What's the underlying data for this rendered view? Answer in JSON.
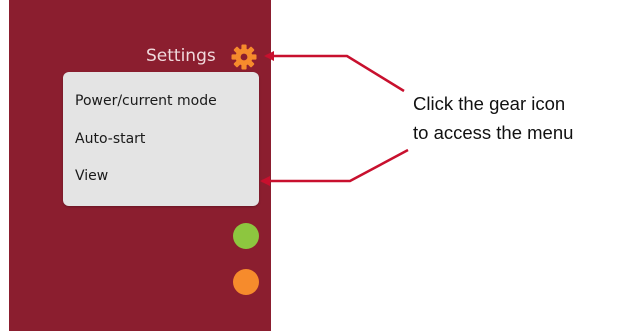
{
  "settings": {
    "label": "Settings",
    "icon": "gear-icon",
    "icon_color": "#f68b2c"
  },
  "menu": {
    "items": [
      {
        "label": "Power/current mode"
      },
      {
        "label": "Auto-start"
      },
      {
        "label": "View"
      }
    ]
  },
  "status_indicators": [
    {
      "color": "#8dc63f"
    },
    {
      "color": "#f68b2c"
    }
  ],
  "callout": {
    "line1": "Click the gear icon",
    "line2": "to access the menu",
    "arrow_color": "#c8102e"
  },
  "colors": {
    "panel_background": "#8b1e2f",
    "menu_background": "#e4e4e4"
  }
}
